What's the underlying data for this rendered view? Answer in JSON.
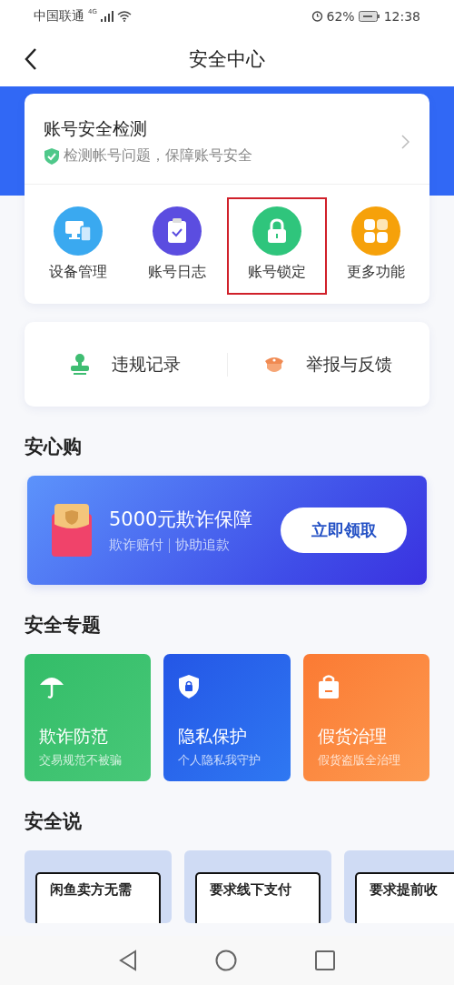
{
  "status_bar": {
    "carrier": "中国联通",
    "network": "4G",
    "battery": "62%",
    "time": "12:38"
  },
  "header": {
    "title": "安全中心"
  },
  "check": {
    "title": "账号安全检测",
    "subtitle": "检测帐号问题，保障账号安全"
  },
  "shortcuts": [
    {
      "label": "设备管理",
      "kind": "devices",
      "highlighted": false
    },
    {
      "label": "账号日志",
      "kind": "log",
      "highlighted": false
    },
    {
      "label": "账号锁定",
      "kind": "lock",
      "highlighted": true
    },
    {
      "label": "更多功能",
      "kind": "more",
      "highlighted": false
    }
  ],
  "links": [
    {
      "label": "违规记录",
      "kind": "record"
    },
    {
      "label": "举报与反馈",
      "kind": "report"
    }
  ],
  "shop": {
    "heading": "安心购",
    "banner_title": "5000元欺诈保障",
    "banner_sub_1": "欺诈赔付",
    "banner_sub_2": "协助追款",
    "button": "立即领取"
  },
  "topics": {
    "heading": "安全专题",
    "items": [
      {
        "title": "欺诈防范",
        "subtitle": "交易规范不被骗",
        "kind": "umbrella"
      },
      {
        "title": "隐私保护",
        "subtitle": "个人隐私我守护",
        "kind": "shield"
      },
      {
        "title": "假货治理",
        "subtitle": "假货盗版全治理",
        "kind": "bag"
      }
    ]
  },
  "talk": {
    "heading": "安全说",
    "items": [
      {
        "title": "闲鱼卖方无需"
      },
      {
        "title": "要求线下支付"
      },
      {
        "title": "要求提前收"
      }
    ]
  }
}
